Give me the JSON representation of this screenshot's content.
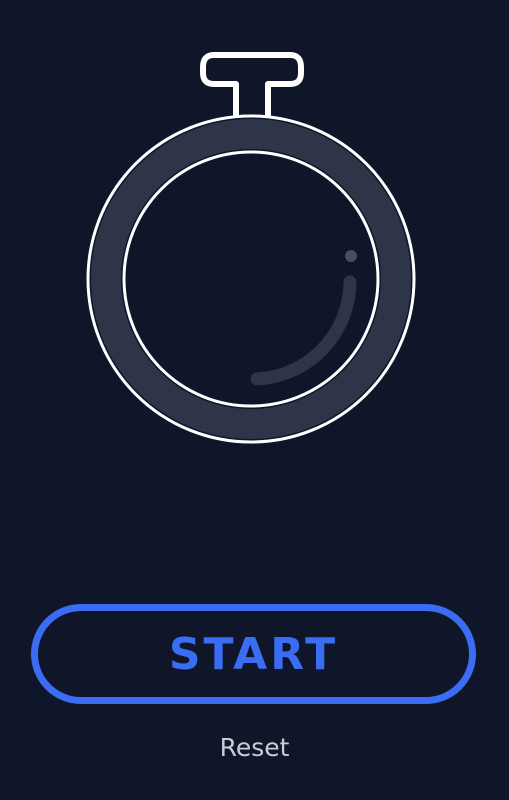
{
  "app": {
    "background_color": "#10162a",
    "accent_color": "#3a6cf4"
  },
  "stopwatch": {
    "icon": "stopwatch-icon",
    "outline_color": "#ffffff",
    "ring_color": "#2f3548",
    "hand_color": "#2f3548",
    "dot_color": "#4a4f5f"
  },
  "controls": {
    "start_label": "START",
    "reset_label": "Reset"
  }
}
